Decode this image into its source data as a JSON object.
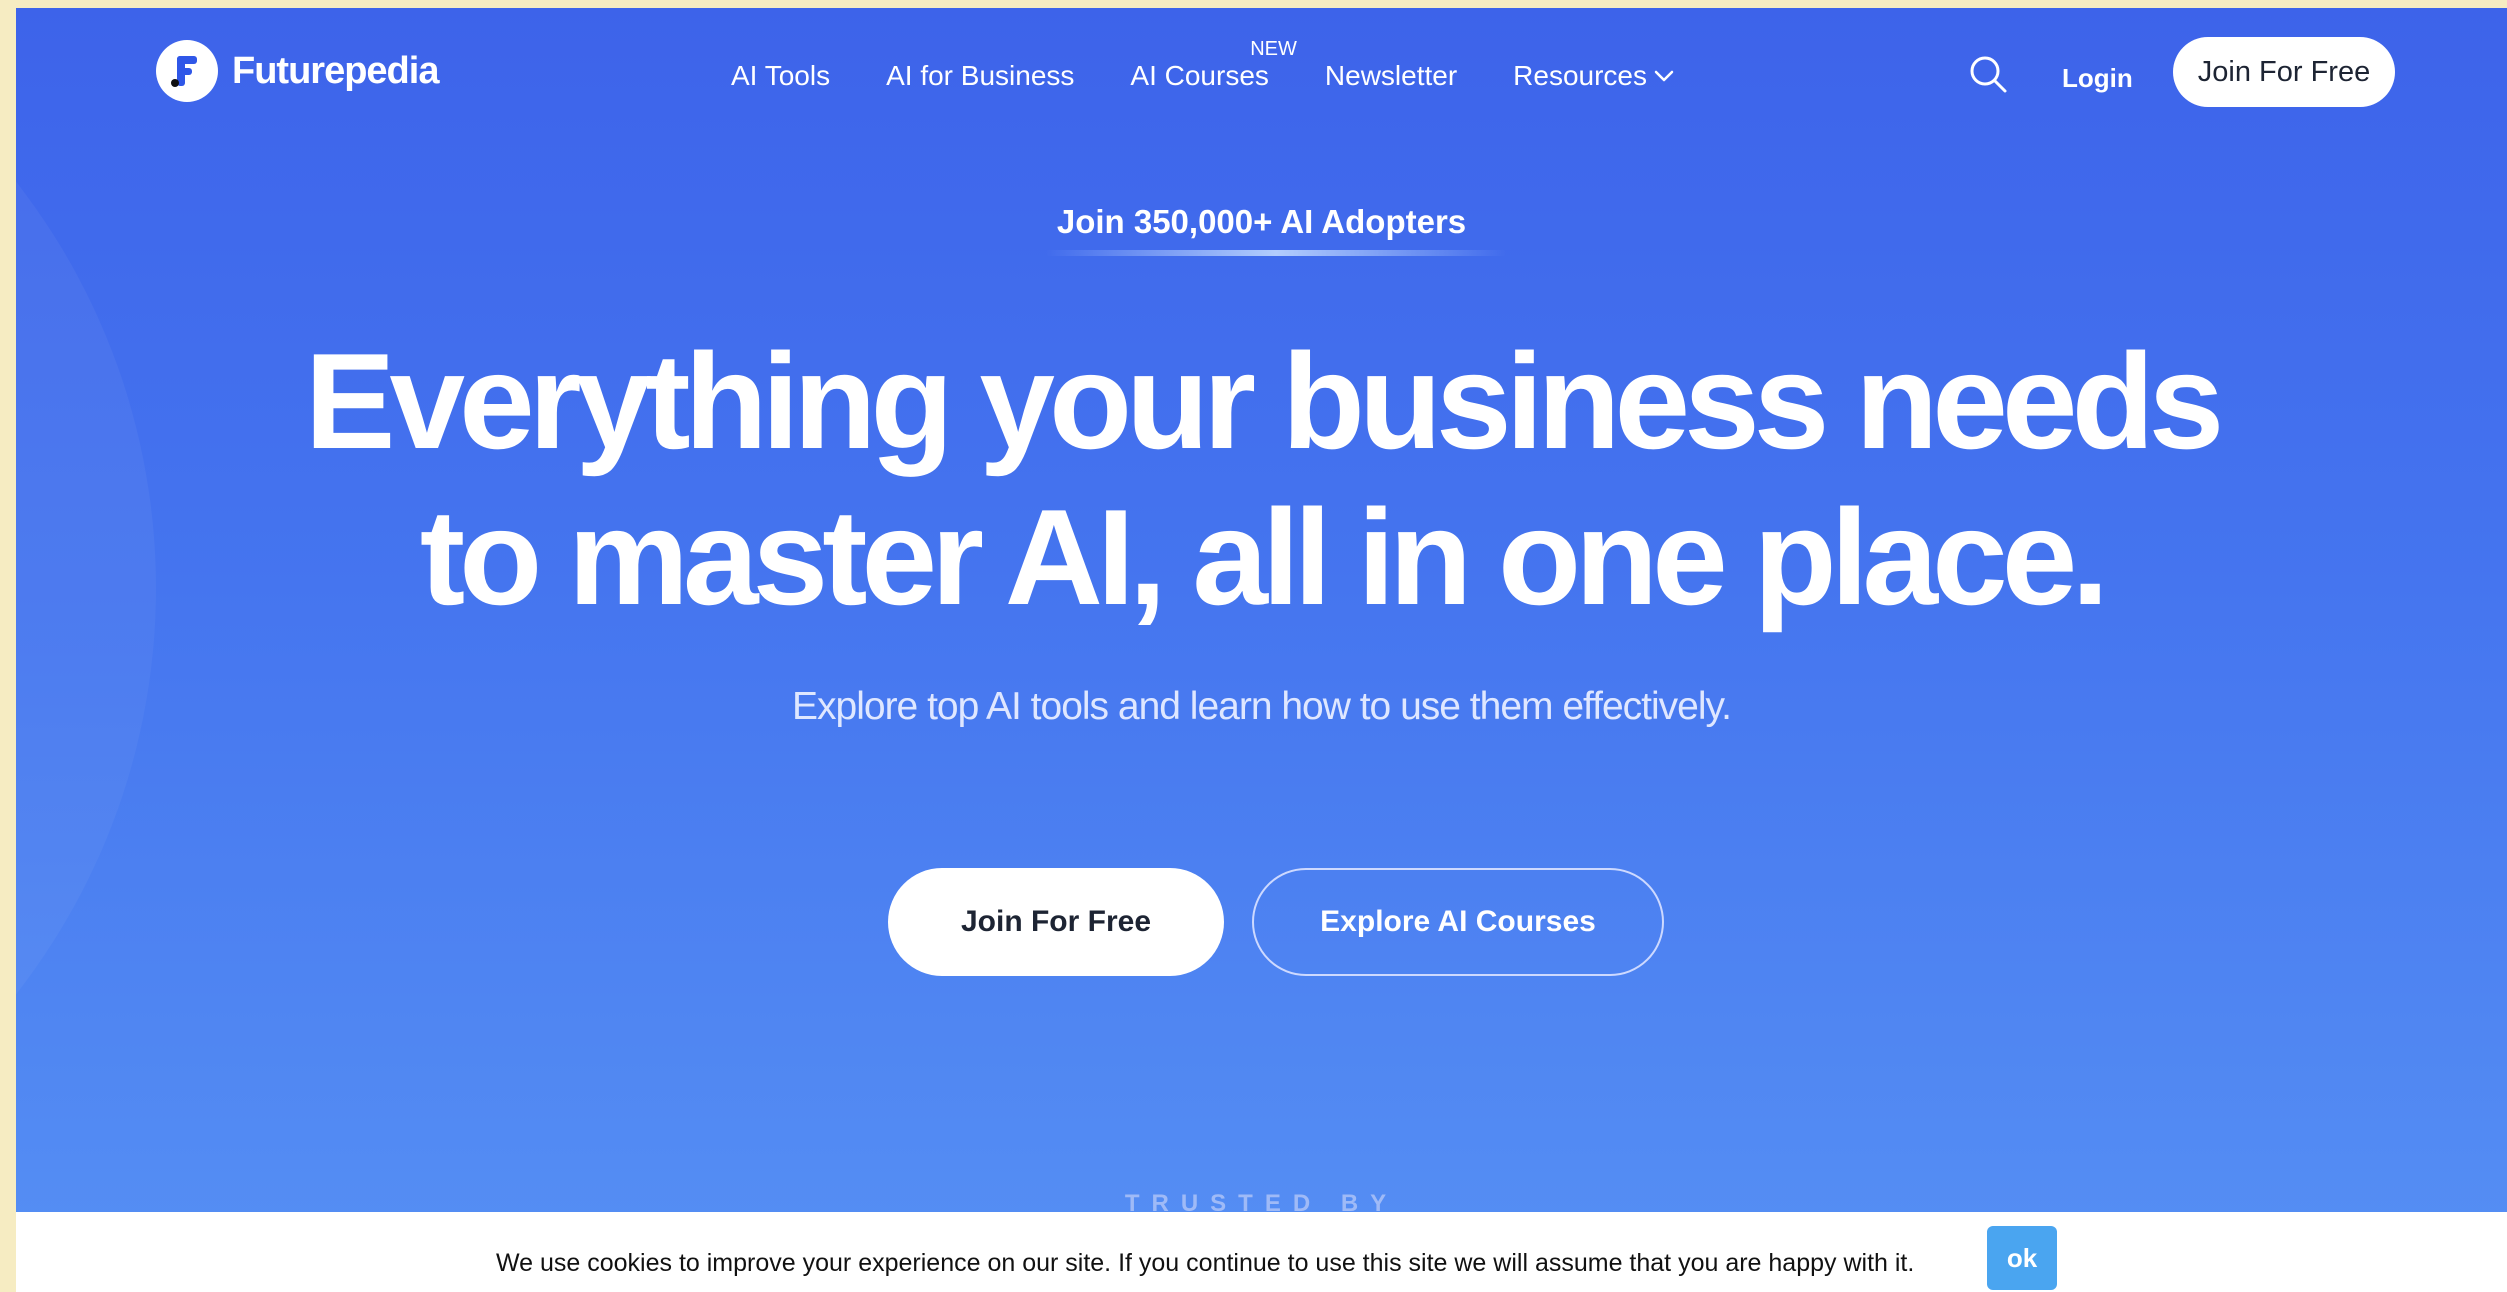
{
  "header": {
    "logo_text": "Futurepedia",
    "nav": [
      {
        "label": "AI Tools"
      },
      {
        "label": "AI for Business"
      },
      {
        "label": "AI Courses",
        "badge": "NEW"
      },
      {
        "label": "Newsletter"
      },
      {
        "label": "Resources"
      }
    ],
    "login_label": "Login",
    "join_label": "Join For Free"
  },
  "hero": {
    "tagline": "Join 350,000+ AI Adopters",
    "headline_line1": "Everything your business needs",
    "headline_line2": "to master AI, all in one place.",
    "subtitle": "Explore top AI tools and learn how to use them effectively.",
    "cta_primary": "Join For Free",
    "cta_secondary": "Explore AI Courses",
    "trusted_label": "TRUSTED BY"
  },
  "cookie": {
    "text": "We use cookies to improve your experience on our site. If you continue to use this site we will assume that you are happy with it.",
    "ok_label": "ok"
  },
  "colors": {
    "background_top": "#3d63ea",
    "background_bottom": "#5690f4",
    "button_text": "#1d2433",
    "ok_button": "#4aa5f0"
  },
  "icons": [
    "futurepedia-logo-icon",
    "search-icon",
    "chevron-down-icon"
  ]
}
